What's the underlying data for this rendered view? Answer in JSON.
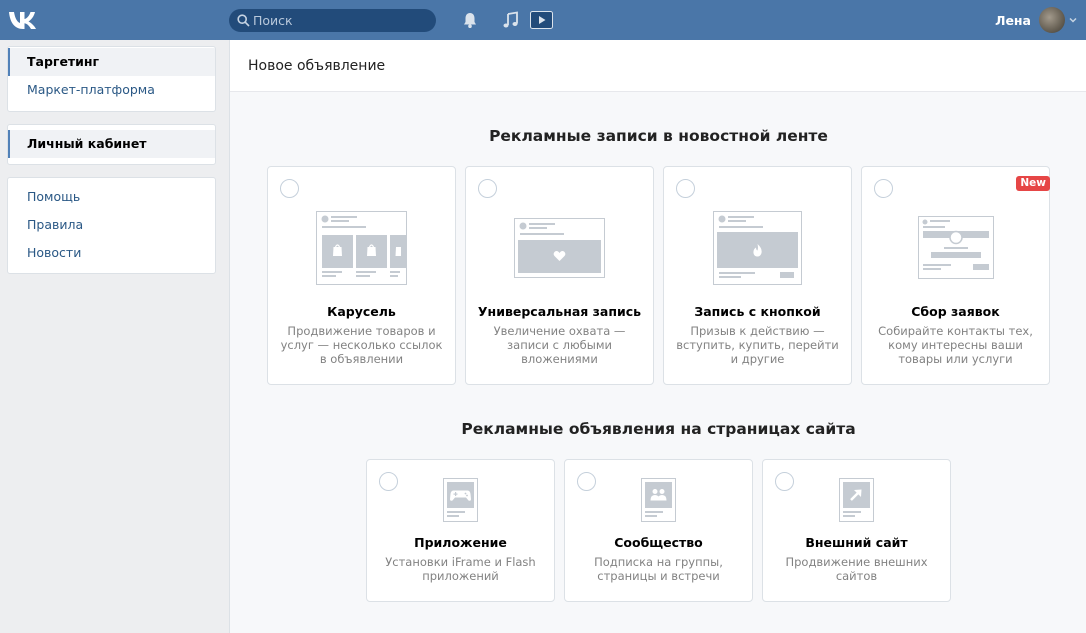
{
  "header": {
    "logo_icon": "vk-logo-icon",
    "search_placeholder": "Поиск",
    "user_name": "Лена",
    "accent_color": "#4a76a8"
  },
  "sidebar": {
    "group1": [
      {
        "label": "Таргетинг",
        "active": true
      },
      {
        "label": "Маркет-платформа",
        "active": false
      }
    ],
    "group2": [
      {
        "label": "Личный кабинет",
        "active": true
      }
    ],
    "group3": [
      {
        "label": "Помощь"
      },
      {
        "label": "Правила"
      },
      {
        "label": "Новости"
      }
    ]
  },
  "main": {
    "title": "Новое объявление",
    "section1": {
      "title": "Рекламные записи в новостной ленте",
      "cards": [
        {
          "title": "Карусель",
          "desc": "Продвижение товаров и услуг — несколько ссылок в объявлении",
          "icon": "carousel-icon"
        },
        {
          "title": "Универсальная запись",
          "desc": "Увеличение охвата — записи с любыми вложениями",
          "icon": "universal-post-icon"
        },
        {
          "title": "Запись с кнопкой",
          "desc": "Призыв к действию — вступить, купить, перейти и другие",
          "icon": "button-post-icon"
        },
        {
          "title": "Сбор заявок",
          "desc": "Собирайте контакты тех, кому интересны ваши товары или услуги",
          "icon": "lead-form-icon",
          "badge": "New"
        }
      ]
    },
    "section2": {
      "title": "Рекламные объявления на страницах сайта",
      "cards": [
        {
          "title": "Приложение",
          "desc": "Установки iFrame и Flash приложений",
          "icon": "gamepad-icon"
        },
        {
          "title": "Сообщество",
          "desc": "Подписка на группы, страницы и встречи",
          "icon": "community-icon"
        },
        {
          "title": "Внешний сайт",
          "desc": "Продвижение внешних сайтов",
          "icon": "external-link-icon"
        }
      ]
    }
  }
}
